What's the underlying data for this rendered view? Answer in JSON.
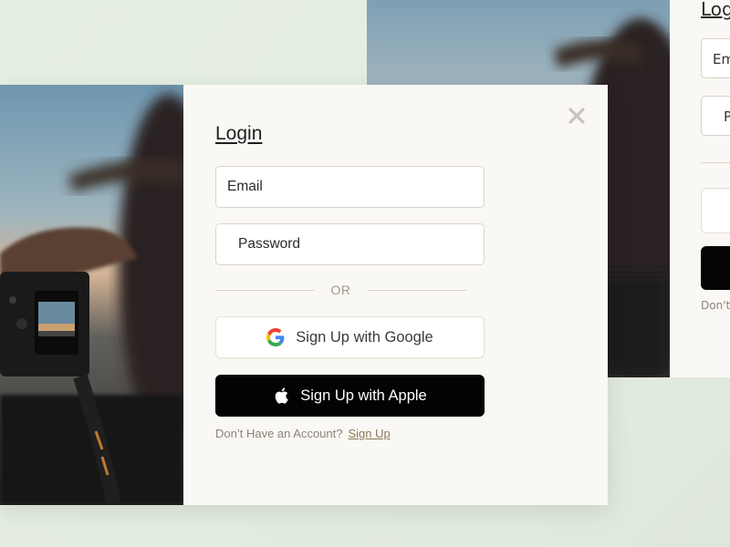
{
  "background_card": {
    "title": "Login",
    "email_placeholder": "Email",
    "password_placeholder": "Password",
    "footer_text": "Don't"
  },
  "login": {
    "title": "Login",
    "email_placeholder": "Email",
    "password_placeholder": "Password",
    "divider_text": "OR",
    "google_button_label": "Sign Up with Google",
    "apple_button_label": "Sign Up with Apple",
    "footer_prompt": "Don’t Have an Account?",
    "signup_link": "Sign Up"
  },
  "icons": {
    "close": "close-icon",
    "google": "google-logo-icon",
    "apple": "apple-logo-icon"
  },
  "colors": {
    "panel_bg": "#faf8f4",
    "apple_button": "#030303",
    "link": "#8a7a58",
    "page_bg": "#e3ece0"
  }
}
